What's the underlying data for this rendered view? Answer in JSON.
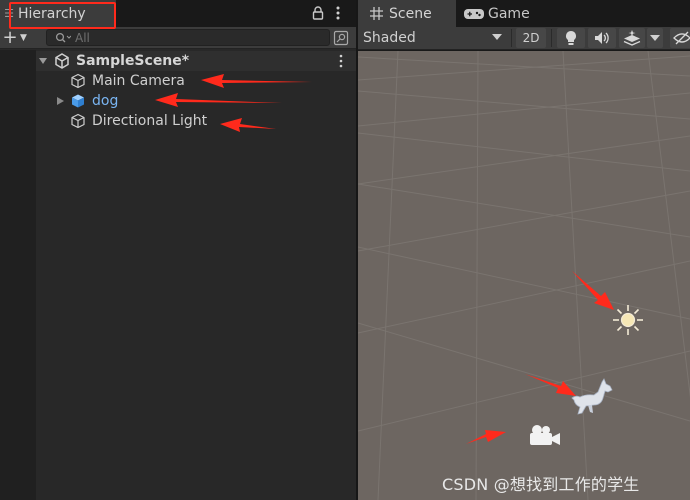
{
  "hierarchy": {
    "tab_label": "Hierarchy",
    "search": {
      "placeholder": "All",
      "value": ""
    },
    "scene": {
      "name": "SampleScene*"
    },
    "objects": [
      {
        "name": "Main Camera",
        "icon": "gameobject-cube-icon",
        "prefab": false
      },
      {
        "name": "dog",
        "icon": "prefab-cube-icon",
        "prefab": true
      },
      {
        "name": "Directional Light",
        "icon": "gameobject-cube-icon",
        "prefab": false
      }
    ]
  },
  "scene_view": {
    "tabs": [
      {
        "label": "Scene",
        "icon": "grid-icon",
        "active": true
      },
      {
        "label": "Game",
        "icon": "gamepad-icon",
        "active": false
      }
    ],
    "shading_mode": "Shaded",
    "toggle_2d_label": "2D",
    "gizmos": [
      "sun-gizmo",
      "dog-model",
      "camera-gizmo"
    ]
  },
  "colors": {
    "annotation_red": "#ff2a1c",
    "prefab_blue": "#7ab5f2",
    "viewport_bg": "#6d6661"
  },
  "watermark": "CSDN @想找到工作的学生"
}
